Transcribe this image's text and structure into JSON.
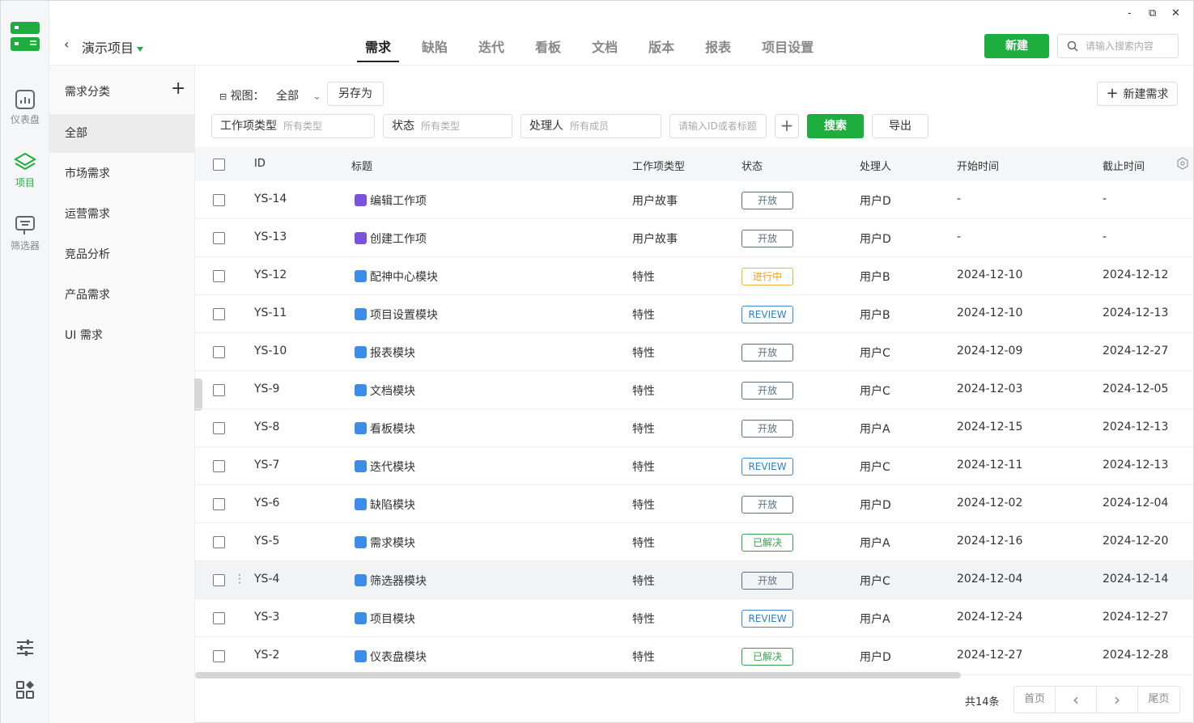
{
  "app": {
    "window": {
      "minimize": "-",
      "maximize": "⧉",
      "close": "✕"
    },
    "rail": {
      "items": [
        {
          "label": "仪表盘",
          "icon": "dashboard-icon"
        },
        {
          "label": "项目",
          "icon": "layers-icon",
          "active": true
        },
        {
          "label": "筛选器",
          "icon": "filter-icon"
        }
      ],
      "bottom_icons": [
        "sliders-icon",
        "apps-grid-icon"
      ],
      "accent": "#1dae3d"
    },
    "header": {
      "back": "‹",
      "project_title": "演示项目",
      "tabs": [
        {
          "label": "需求",
          "active": true
        },
        {
          "label": "缺陷"
        },
        {
          "label": "迭代"
        },
        {
          "label": "看板"
        },
        {
          "label": "文档"
        },
        {
          "label": "版本"
        },
        {
          "label": "报表"
        },
        {
          "label": "项目设置"
        }
      ],
      "new_button": "新建",
      "search_placeholder": "请输入搜索内容"
    },
    "categories": {
      "header": "需求分类",
      "add": "+",
      "items": [
        "全部",
        "市场需求",
        "运营需求",
        "竞品分析",
        "产品需求",
        "UI 需求"
      ],
      "active_index": 0
    },
    "toolbar": {
      "view_label": "视图：",
      "view_value": "全部",
      "save_as": "另存为",
      "new_requirement": "新建需求",
      "filters": [
        {
          "label": "工作项类型",
          "placeholder": "所有类型"
        },
        {
          "label": "状态",
          "placeholder": "所有类型"
        },
        {
          "label": "处理人",
          "placeholder": "所有成员"
        }
      ],
      "id_search_placeholder": "请输入ID或者标题",
      "add_filter": "+",
      "search": "搜索",
      "export": "导出"
    },
    "table": {
      "columns": [
        "ID",
        "标题",
        "工作项类型",
        "状态",
        "处理人",
        "开始时间",
        "截止时间"
      ],
      "rows": [
        {
          "id": "YS-14",
          "title": "编辑工作项",
          "type": "用户故事",
          "status": "开放",
          "status_kind": "open",
          "assignee": "用户D",
          "start": "-",
          "end": "-",
          "icon": "story"
        },
        {
          "id": "YS-13",
          "title": "创建工作项",
          "type": "用户故事",
          "status": "开放",
          "status_kind": "open",
          "assignee": "用户D",
          "start": "-",
          "end": "-",
          "icon": "story"
        },
        {
          "id": "YS-12",
          "title": "配神中心模块",
          "type": "特性",
          "status": "进行中",
          "status_kind": "progress",
          "assignee": "用户B",
          "start": "2024-12-10",
          "end": "2024-12-12",
          "icon": "feature"
        },
        {
          "id": "YS-11",
          "title": "项目设置模块",
          "type": "特性",
          "status": "REVIEW",
          "status_kind": "review",
          "assignee": "用户B",
          "start": "2024-12-10",
          "end": "2024-12-13",
          "icon": "feature"
        },
        {
          "id": "YS-10",
          "title": "报表模块",
          "type": "特性",
          "status": "开放",
          "status_kind": "open",
          "assignee": "用户C",
          "start": "2024-12-09",
          "end": "2024-12-27",
          "icon": "feature"
        },
        {
          "id": "YS-9",
          "title": "文档模块",
          "type": "特性",
          "status": "开放",
          "status_kind": "open",
          "assignee": "用户C",
          "start": "2024-12-03",
          "end": "2024-12-05",
          "icon": "feature"
        },
        {
          "id": "YS-8",
          "title": "看板模块",
          "type": "特性",
          "status": "开放",
          "status_kind": "open",
          "assignee": "用户A",
          "start": "2024-12-15",
          "end": "2024-12-13",
          "icon": "feature"
        },
        {
          "id": "YS-7",
          "title": "迭代模块",
          "type": "特性",
          "status": "REVIEW",
          "status_kind": "review",
          "assignee": "用户C",
          "start": "2024-12-11",
          "end": "2024-12-13",
          "icon": "feature"
        },
        {
          "id": "YS-6",
          "title": "缺陷模块",
          "type": "特性",
          "status": "开放",
          "status_kind": "open",
          "assignee": "用户D",
          "start": "2024-12-02",
          "end": "2024-12-04",
          "icon": "feature"
        },
        {
          "id": "YS-5",
          "title": "需求模块",
          "type": "特性",
          "status": "已解决",
          "status_kind": "resolved",
          "assignee": "用户A",
          "start": "2024-12-16",
          "end": "2024-12-20",
          "icon": "feature"
        },
        {
          "id": "YS-4",
          "title": "筛选器模块",
          "type": "特性",
          "status": "开放",
          "status_kind": "open",
          "assignee": "用户C",
          "start": "2024-12-04",
          "end": "2024-12-14",
          "icon": "feature",
          "hover": true,
          "drag": "⋮"
        },
        {
          "id": "YS-3",
          "title": "项目模块",
          "type": "特性",
          "status": "REVIEW",
          "status_kind": "review",
          "assignee": "用户A",
          "start": "2024-12-24",
          "end": "2024-12-27",
          "icon": "feature"
        },
        {
          "id": "YS-2",
          "title": "仪表盘模块",
          "type": "特性",
          "status": "已解决",
          "status_kind": "resolved",
          "assignee": "用户D",
          "start": "2024-12-27",
          "end": "2024-12-28",
          "icon": "feature"
        }
      ]
    },
    "pagination": {
      "total": "共14条",
      "first": "首页",
      "prev": "‹",
      "next": "›",
      "last": "尾页"
    }
  }
}
